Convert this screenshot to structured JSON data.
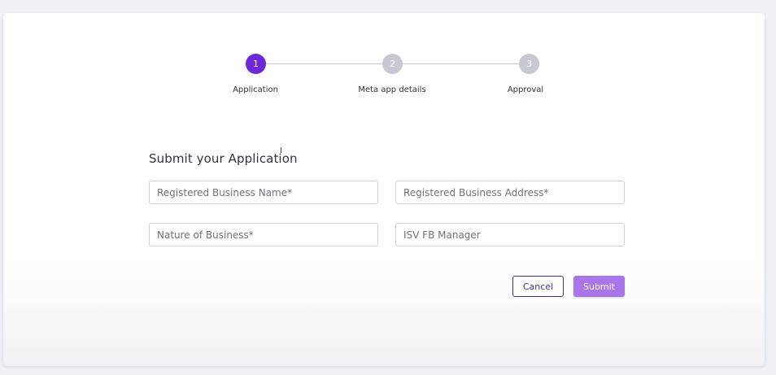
{
  "stepper": {
    "steps": [
      {
        "number": "1",
        "label": "Application",
        "state": "active"
      },
      {
        "number": "2",
        "label": "Meta app details",
        "state": "inactive"
      },
      {
        "number": "3",
        "label": "Approval",
        "state": "inactive"
      }
    ]
  },
  "form": {
    "title": "Submit your Application",
    "fields": {
      "business_name": {
        "placeholder": "Registered Business Name*",
        "value": ""
      },
      "business_address": {
        "placeholder": "Registered Business Address*",
        "value": ""
      },
      "nature_of_business": {
        "placeholder": "Nature of Business*",
        "value": ""
      },
      "isv_fb_manager": {
        "placeholder": "ISV FB Manager",
        "value": ""
      }
    }
  },
  "actions": {
    "cancel_label": "Cancel",
    "submit_label": "Submit"
  },
  "colors": {
    "accent": "#6d28d9",
    "submit_bg": "#a876e8",
    "inactive_step": "#c6c9d2"
  },
  "icons": {
    "cursor": "text-cursor-icon"
  }
}
